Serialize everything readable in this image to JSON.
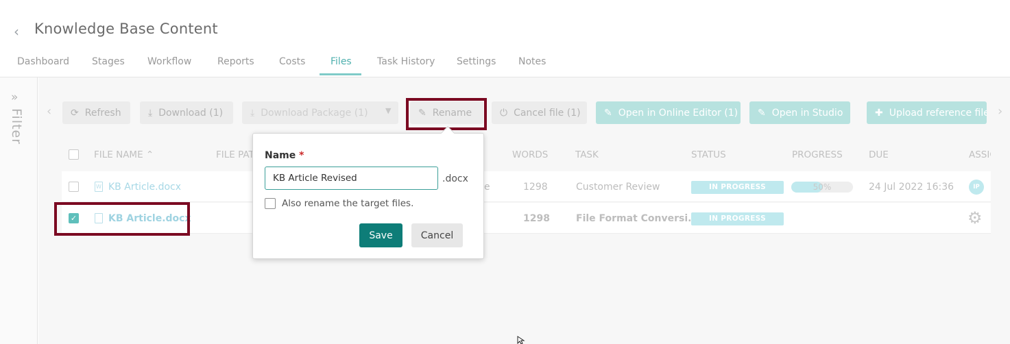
{
  "header": {
    "back_glyph": "‹",
    "title": "Knowledge Base Content"
  },
  "tabs": [
    {
      "label": "Dashboard"
    },
    {
      "label": "Stages"
    },
    {
      "label": "Workflow"
    },
    {
      "label": "Reports"
    },
    {
      "label": "Costs"
    },
    {
      "label": "Files",
      "active": true
    },
    {
      "label": "Task History"
    },
    {
      "label": "Settings"
    },
    {
      "label": "Notes"
    }
  ],
  "filter": {
    "label": "Filter",
    "icon": "double-chevron-right-icon"
  },
  "toolbar": {
    "refresh": "Refresh",
    "download": "Download (1)",
    "download_package": "Download Package (1)",
    "rename": "Rename",
    "cancel_file": "Cancel file (1)",
    "open_online_editor": "Open in Online Editor (1)",
    "open_studio": "Open in Studio",
    "upload_reference": "Upload reference files"
  },
  "table": {
    "columns": {
      "file_name": "FILE NAME",
      "file_path": "FILE PAT",
      "words": "WORDS",
      "task": "TASK",
      "status": "STATUS",
      "progress": "PROGRESS",
      "due": "DUE",
      "assignee": "ASSIG"
    },
    "rows": [
      {
        "file_name": "KB Article.docx",
        "file_icon_letter": "W",
        "file_path_fragment": "e",
        "words": "1298",
        "task": "Customer Review",
        "status": "IN PROGRESS",
        "progress_text": "50%",
        "progress_value": 0.5,
        "due": "24 Jul 2022 16:36",
        "assignee_initials": "IP",
        "checked": false
      },
      {
        "file_name": "KB Article.docx",
        "file_path_fragment": "",
        "words": "1298",
        "task": "File Format Conversi...",
        "status": "IN PROGRESS",
        "checked": true
      }
    ]
  },
  "rename_dialog": {
    "name_label": "Name",
    "required_marker": "*",
    "name_value": "KB Article Revised",
    "extension": ".docx",
    "also_rename_label": "Also rename the target files.",
    "also_rename_checked": false,
    "save": "Save",
    "cancel": "Cancel"
  },
  "colors": {
    "accent_teal": "#0e7d78",
    "highlight_border": "#7b0a22",
    "status_badge": "#bfe9ee"
  }
}
